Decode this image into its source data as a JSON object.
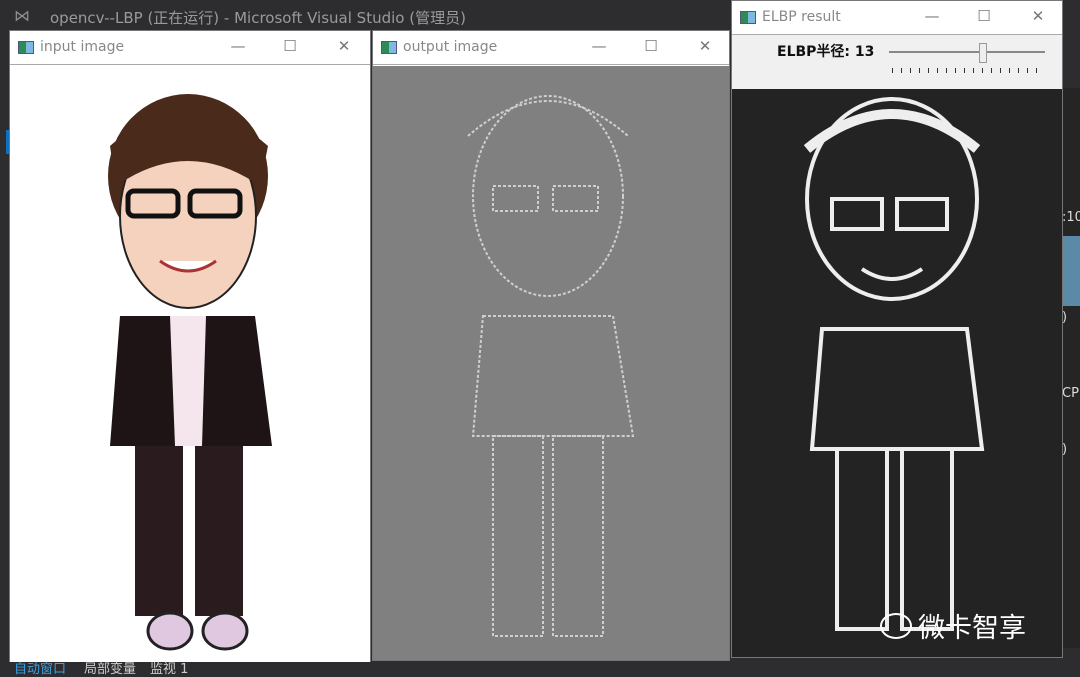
{
  "vs": {
    "title": "opencv--LBP (正在运行) - Microsoft Visual Studio (管理员)"
  },
  "right_panel": {
    "frag1": ":10",
    "frag2": ")",
    "frag3": "CP",
    "frag4": ")"
  },
  "windows": [
    {
      "title": "input image",
      "min": "—",
      "max": "☐",
      "close": "✕"
    },
    {
      "title": "output image",
      "min": "—",
      "max": "☐",
      "close": "✕"
    },
    {
      "title": "ELBP result",
      "min": "—",
      "max": "☐",
      "close": "✕"
    }
  ],
  "trackbar": {
    "label": "ELBP半径: 13",
    "value": 13,
    "fraction": 0.6
  },
  "watermark": "微卡智享",
  "bottom_tabs": [
    "自动窗口",
    "局部变量",
    "监视 1"
  ],
  "colors": {
    "output_bg": "#808080",
    "elbp_bg": "#232323",
    "active_tab": "#0e70c0"
  }
}
